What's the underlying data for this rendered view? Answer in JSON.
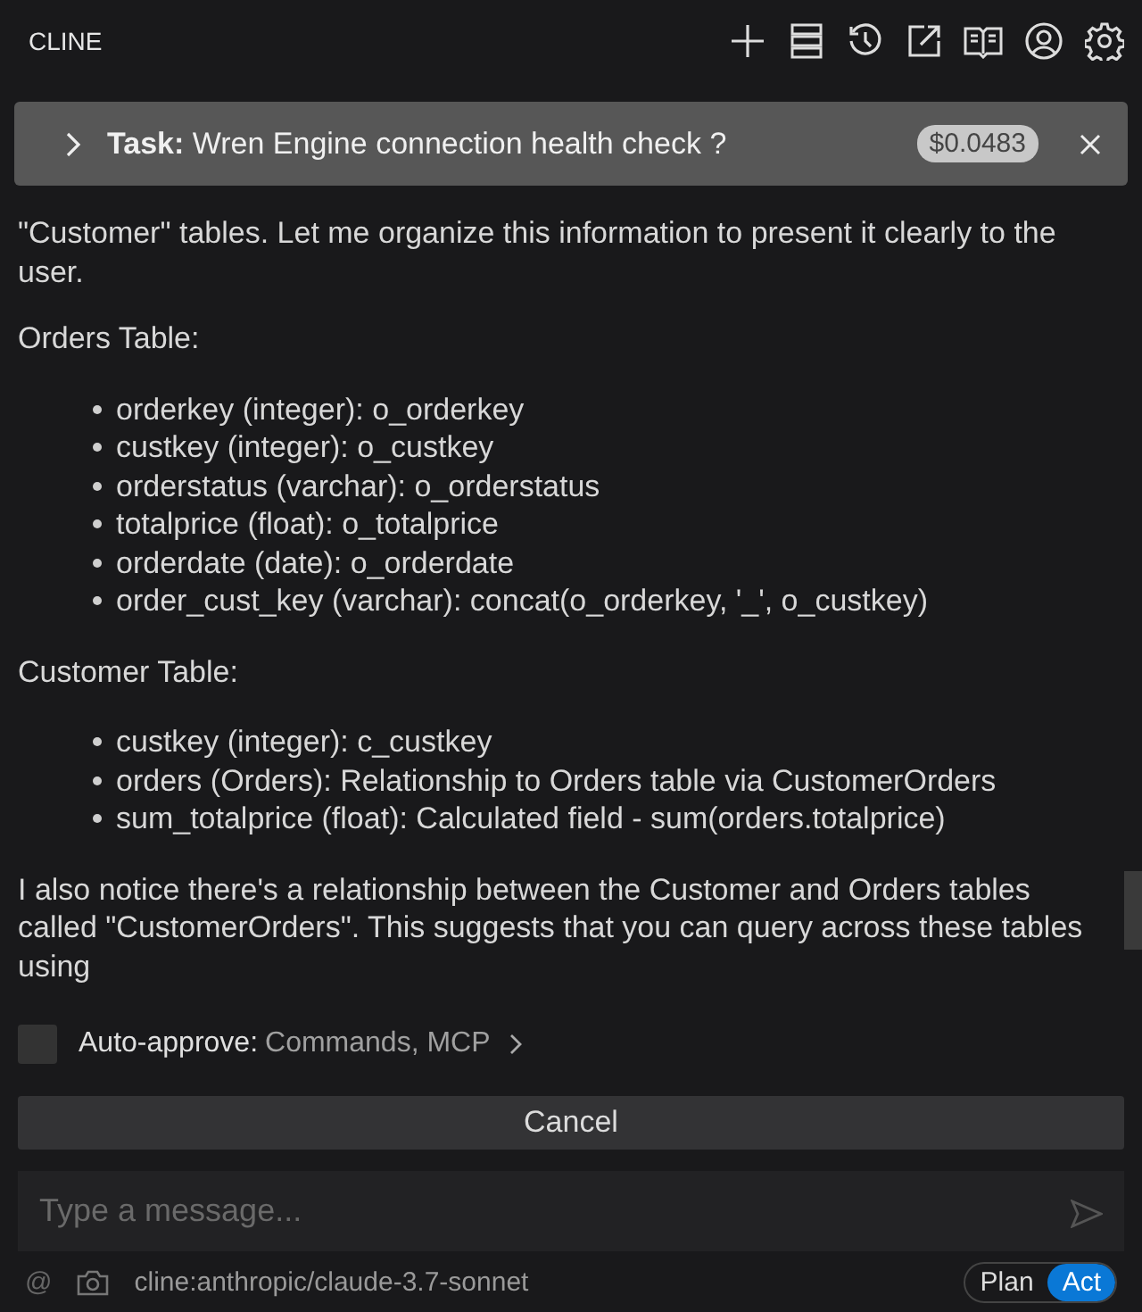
{
  "header": {
    "title": "CLINE"
  },
  "task": {
    "label": "Task:",
    "title": "Wren Engine connection health check ?",
    "cost": "$0.0483"
  },
  "message": {
    "blocks": [
      {
        "kind": "paragraph",
        "text": "\"Customer\" tables. Let me organize this information to present it clearly to the user."
      },
      {
        "kind": "paragraph",
        "text": "Orders Table:"
      },
      {
        "kind": "list",
        "items": [
          "orderkey (integer): o_orderkey",
          "custkey (integer): o_custkey",
          "orderstatus (varchar): o_orderstatus",
          "totalprice (float): o_totalprice",
          "orderdate (date): o_orderdate",
          "order_cust_key (varchar): concat(o_orderkey, '_', o_custkey)"
        ]
      },
      {
        "kind": "paragraph",
        "text": "Customer Table:"
      },
      {
        "kind": "list",
        "items": [
          "custkey (integer): c_custkey",
          "orders (Orders): Relationship to Orders table via CustomerOrders",
          "sum_totalprice (float): Calculated field - sum(orders.totalprice)"
        ]
      },
      {
        "kind": "paragraph",
        "text": "I also notice there's a relationship between the Customer and Orders tables called \"CustomerOrders\". This suggests that you can query across these tables using"
      }
    ]
  },
  "auto_approve": {
    "checked": false,
    "label": "Auto-approve:",
    "value": "Commands, MCP"
  },
  "cancel_button": "Cancel",
  "input": {
    "placeholder": "Type a message..."
  },
  "footer": {
    "mention": "@",
    "model": "cline:anthropic/claude-3.7-sonnet",
    "modes": [
      {
        "label": "Plan",
        "selected": false
      },
      {
        "label": "Act",
        "selected": true
      }
    ]
  }
}
